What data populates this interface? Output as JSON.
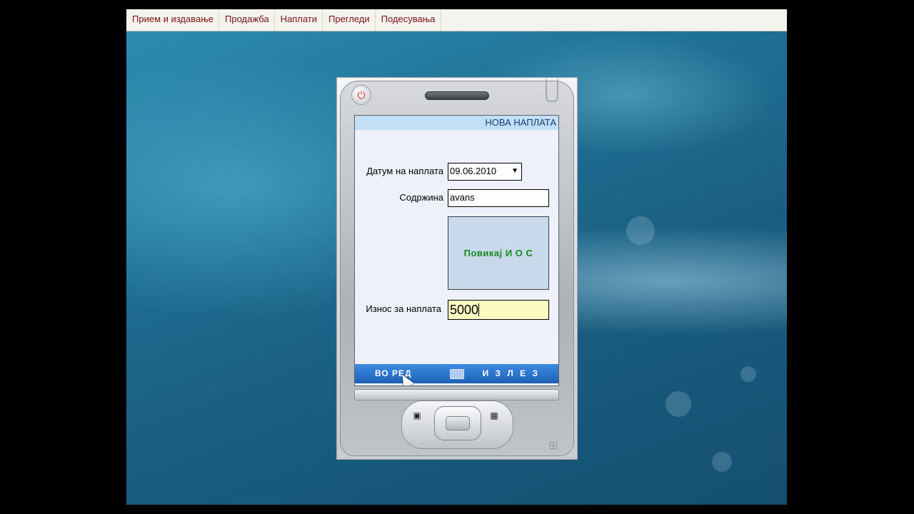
{
  "menu": {
    "items": [
      {
        "label": "Прием и издавање"
      },
      {
        "label": "Продажба"
      },
      {
        "label": "Наплати"
      },
      {
        "label": "Прегледи"
      },
      {
        "label": "Подесувања"
      }
    ]
  },
  "screen": {
    "title": "НОВА НАПЛАТА",
    "date_label": "Датум на наплата",
    "date_value": "09.06.2010",
    "content_label": "Содржина",
    "content_value": "avans",
    "call_button_label": "Повикај  И О С",
    "amount_label": "Износ за наплата",
    "amount_value": "5000",
    "softkey_left": "ВО РЕД",
    "softkey_right": "И З Л Е З"
  },
  "icons": {
    "power": "power-icon",
    "dropdown": "chevron-down-icon",
    "keyboard": "keyboard-icon",
    "cursor": "mouse-pointer-icon",
    "windows": "windows-logo-icon"
  },
  "colors": {
    "menu_text": "#7a1010",
    "title_bar": "#c2dff7",
    "softkey_bar": "#1f5fb8",
    "call_text": "#178a1e",
    "amount_bg": "#fcfcc0"
  }
}
